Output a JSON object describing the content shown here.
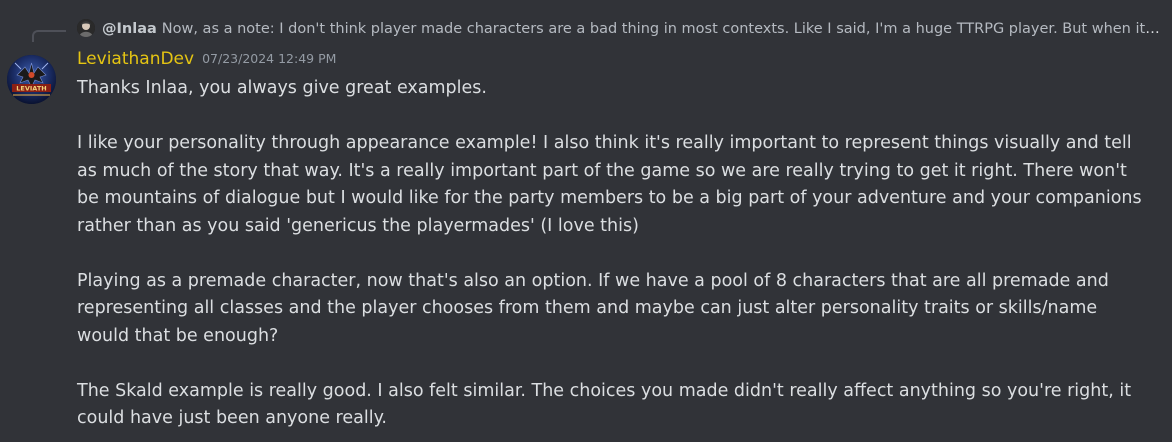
{
  "reply": {
    "author": "@Inlaa",
    "preview": "Now, as a note: I don't think player made characters are a bad thing in most contexts. Like I said, I'm a huge TTRPG player. But when it comes to making a story, having established characters is important."
  },
  "message": {
    "author": "LeviathanDev",
    "timestamp": "07/23/2024 12:49 PM",
    "paragraphs": [
      "Thanks Inlaa, you always give great examples.",
      "I like your personality through appearance example! I also think it's really important to represent things visually and tell as much of the story that way. It's a really important part of the game so we are really trying to get it right. There won't be mountains of dialogue but I would like for the party members to be a big part of your adventure and your companions rather than as you said 'genericus the playermades' (I love this)",
      "Playing as a premade character, now that's also an option. If we have a pool of 8 characters that are all premade and representing all classes and the player chooses from them and maybe can just alter personality traits or skills/name would that be enough?",
      "The Skald example is really good. I also felt similar. The choices you made didn't really affect anything so you're right, it could have just been anyone really."
    ]
  },
  "avatar": {
    "logo_text": "LEVIATH"
  },
  "colors": {
    "background": "#313338",
    "username": "#e5c513",
    "text": "#dbdee1",
    "muted": "#949ba4"
  }
}
